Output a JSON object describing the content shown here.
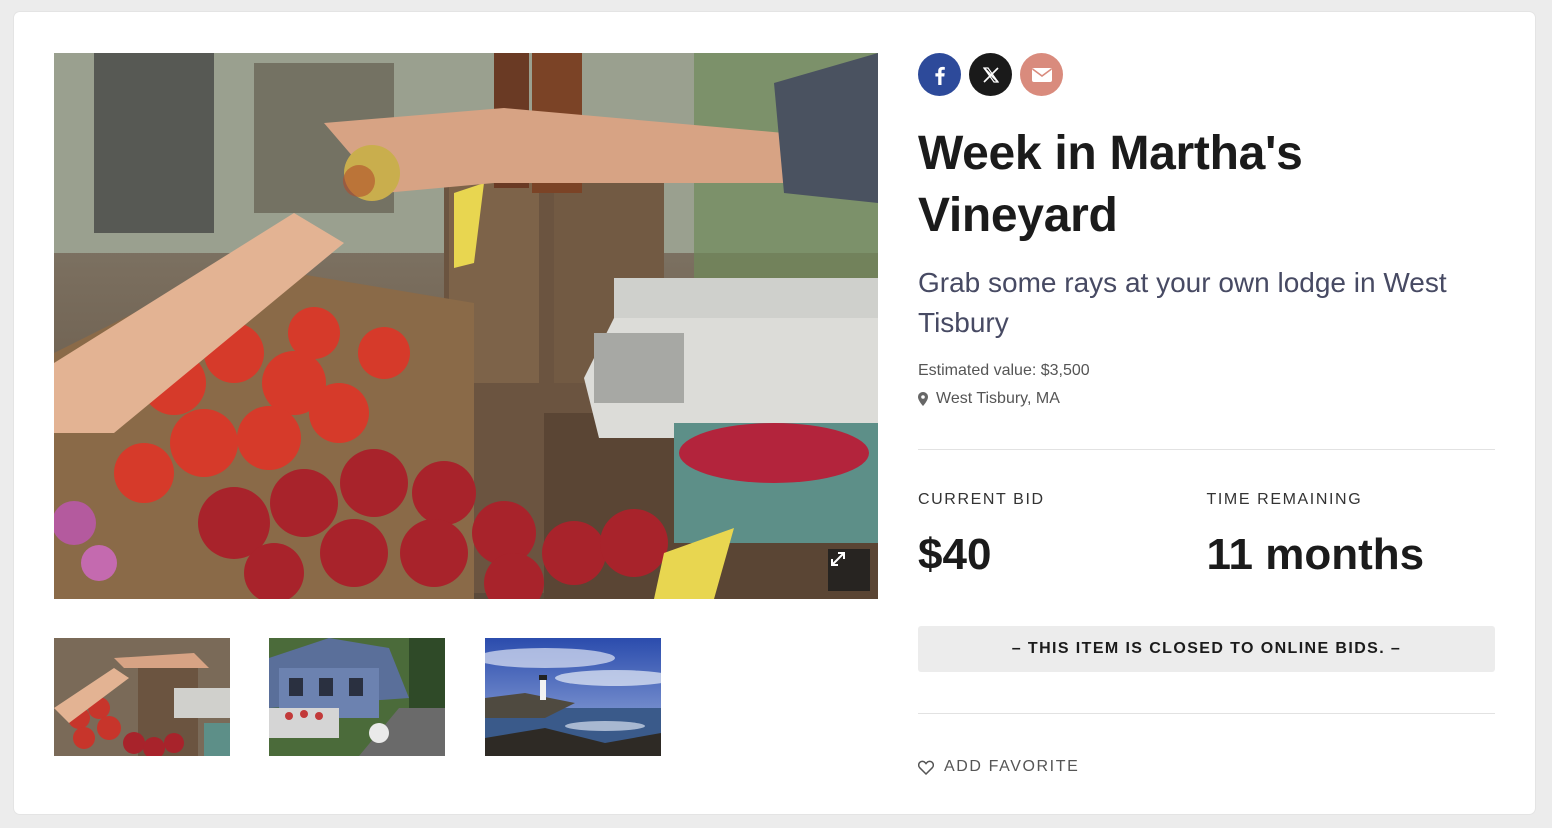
{
  "share": {
    "facebook_icon": "facebook-icon",
    "x_icon": "x-logo-icon",
    "email_icon": "email-icon",
    "colors": {
      "facebook": "#2d4a9a",
      "x": "#1a1a1a",
      "email": "#d98b7d"
    }
  },
  "item": {
    "title": "Week in Martha's Vineyard",
    "subtitle": "Grab some rays at your own lodge in West Tisbury",
    "estimated_value": "Estimated value: $3,500",
    "location": "West Tisbury, MA"
  },
  "bidding": {
    "current_bid_label": "CURRENT BID",
    "current_bid_value": "$40",
    "time_remaining_label": "TIME REMAINING",
    "time_remaining_value": "11 months",
    "closed_notice": "– THIS ITEM IS CLOSED TO ONLINE BIDS. –"
  },
  "favorite": {
    "label": "ADD FAVORITE",
    "icon": "heart-icon"
  },
  "gallery": {
    "main_image": "farmers-market-fruit-photo",
    "expand_icon": "expand-icon",
    "thumbnails": [
      "farmers-market-thumbnail",
      "village-street-thumbnail",
      "lighthouse-coast-thumbnail"
    ]
  }
}
